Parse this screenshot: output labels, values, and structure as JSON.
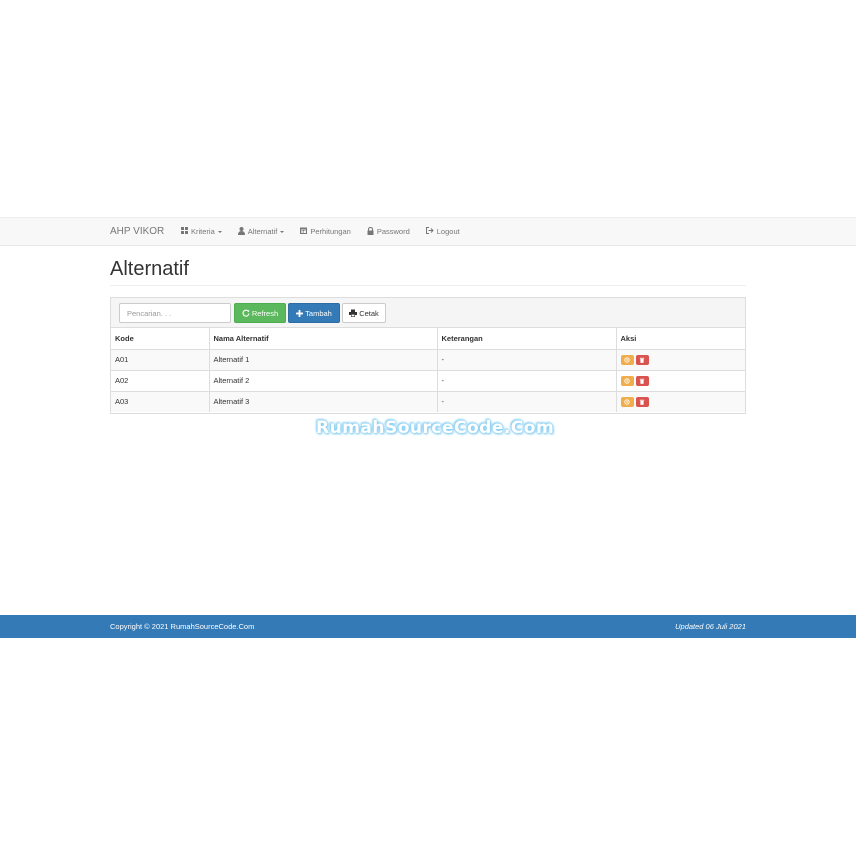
{
  "navbar": {
    "brand": "AHP VIKOR",
    "items": [
      {
        "label": "Kriteria",
        "icon": "grid-icon",
        "dropdown": true
      },
      {
        "label": "Alternatif",
        "icon": "user-icon",
        "dropdown": true
      },
      {
        "label": "Perhitungan",
        "icon": "calendar-icon",
        "dropdown": false
      },
      {
        "label": "Password",
        "icon": "lock-icon",
        "dropdown": false
      },
      {
        "label": "Logout",
        "icon": "logout-icon",
        "dropdown": false
      }
    ]
  },
  "page": {
    "title": "Alternatif"
  },
  "toolbar": {
    "search_placeholder": "Pencarian. . .",
    "search_value": "",
    "refresh_label": "Refresh",
    "tambah_label": "Tambah",
    "cetak_label": "Cetak"
  },
  "table": {
    "headers": [
      "Kode",
      "Nama Alternatif",
      "Keterangan",
      "Aksi"
    ],
    "rows": [
      {
        "kode": "A01",
        "nama": "Alternatif 1",
        "keterangan": "-"
      },
      {
        "kode": "A02",
        "nama": "Alternatif 2",
        "keterangan": "-"
      },
      {
        "kode": "A03",
        "nama": "Alternatif 3",
        "keterangan": "-"
      }
    ]
  },
  "watermark": "RumahSourceCode.Com",
  "footer": {
    "copyright": "Copyright © 2021 RumahSourceCode.Com",
    "updated": "Updated 06 Juli 2021"
  },
  "colors": {
    "primary": "#337ab7",
    "success": "#5cb85c",
    "warning": "#f0ad4e",
    "danger": "#d9534f"
  }
}
